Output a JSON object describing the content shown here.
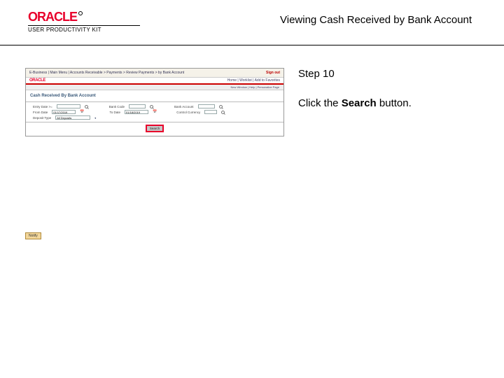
{
  "header": {
    "logo_text": "ORACLE",
    "upk_text": "USER PRODUCTIVITY KIT",
    "page_title": "Viewing Cash Received by Bank Account"
  },
  "screenshot": {
    "breadcrumb": "E-Business | Main Menu | Accounts Receivable > Payments > Review Payments > by Bank Account",
    "logout": "Sign out",
    "logo": "ORACLE",
    "navbar": "Home | Worklist | Add to Favorites",
    "sublinks": "New Window | Help | Personalize Page",
    "heading": "Cash Received By Bank Account",
    "fields": {
      "r1a": "Entry Date >=",
      "r1b": "Bank Code",
      "r1c": "Bank Account",
      "r2a": "From Date",
      "r2a_val": "01/17/2019",
      "r2b": "To Date",
      "r2b_val": "01/18/2019",
      "r2c": "Control Currency",
      "r3a": "Deposit Type",
      "r3a_val": "All Deposits",
      "r3b": ""
    },
    "search_btn": "Search",
    "status_btn": "Notify"
  },
  "instruction": {
    "step": "Step 10",
    "text_before": "Click the ",
    "bold": "Search",
    "text_after": " button."
  }
}
